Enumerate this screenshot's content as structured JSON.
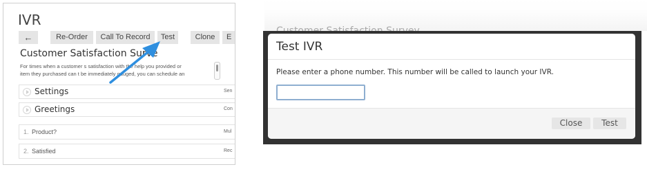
{
  "left_panel": {
    "title": "IVR",
    "toolbar": {
      "back_icon": "←",
      "reorder_label": "Re-Order",
      "call_to_record_label": "Call To Record",
      "test_label": "Test",
      "clone_label": "Clone",
      "truncated_label": "E"
    },
    "survey": {
      "title": "Customer Satisfaction Surve",
      "description_line1": "For times when a customer s satisfaction with the help you provided or",
      "description_line2": "item they purchased can t be immediately gauged, you can schedule an"
    },
    "sections": [
      {
        "label": "Settings",
        "right_text": "Sen"
      },
      {
        "label": "Greetings",
        "right_text": "Con"
      }
    ],
    "questions": [
      {
        "num": "1.",
        "label": "Product?",
        "right_text": "Mul"
      },
      {
        "num": "2.",
        "label": "Satisfied",
        "right_text": "Rec"
      }
    ]
  },
  "background": {
    "ghost_text": "Customer Satisfaction Survey"
  },
  "dialog": {
    "title": "Test IVR",
    "message": "Please enter a phone number. This number will be called to launch your IVR.",
    "phone_value": "",
    "close_label": "Close",
    "test_label": "Test"
  },
  "colors": {
    "arrow": "#2f8fdf",
    "input_border": "#8eaed0",
    "overlay": "#323232"
  }
}
